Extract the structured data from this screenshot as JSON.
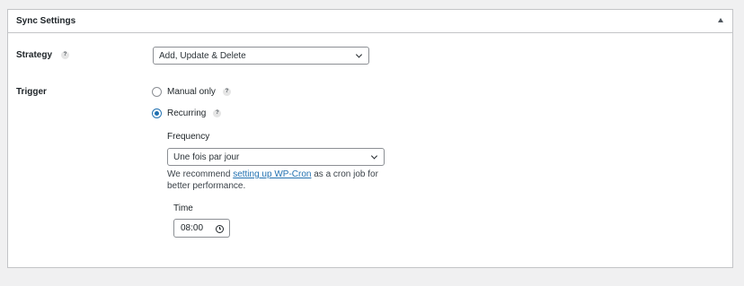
{
  "panel": {
    "title": "Sync Settings",
    "collapse_icon": "triangle-up-icon"
  },
  "strategy": {
    "label": "Strategy",
    "help_glyph": "?",
    "selected": "Add, Update & Delete"
  },
  "trigger": {
    "label": "Trigger",
    "options": [
      {
        "label": "Manual only",
        "checked": false,
        "help_glyph": "?"
      },
      {
        "label": "Recurring",
        "checked": true,
        "help_glyph": "?"
      }
    ]
  },
  "frequency": {
    "label": "Frequency",
    "selected": "Une fois par jour",
    "description_before": "We recommend ",
    "description_link": "setting up WP-Cron",
    "description_after": " as a cron job for better performance."
  },
  "time": {
    "label": "Time",
    "value": "08:00",
    "icon": "clock-icon"
  },
  "colors": {
    "accent": "#2271b1",
    "background": "#f0f0f1",
    "border": "#c3c4c7"
  }
}
